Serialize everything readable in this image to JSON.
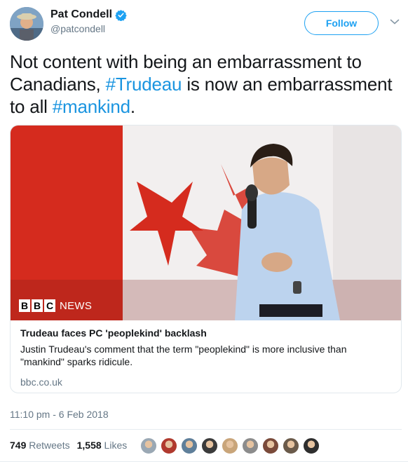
{
  "author": {
    "name": "Pat Condell",
    "handle": "@patcondell"
  },
  "follow_label": "Follow",
  "tweet": {
    "segments": [
      {
        "text": "Not content with being an embarrassment to Canadians, ",
        "hashtag": false
      },
      {
        "text": "#Trudeau",
        "hashtag": true
      },
      {
        "text": " is now an embarrassment to all ",
        "hashtag": false
      },
      {
        "text": "#mankind",
        "hashtag": true
      },
      {
        "text": ".",
        "hashtag": false
      }
    ]
  },
  "card": {
    "brand_letters": [
      "B",
      "B",
      "C"
    ],
    "brand_suffix": "NEWS",
    "title": "Trudeau faces PC 'peoplekind' backlash",
    "description": "Justin Trudeau's comment that the term \"peoplekind\" is more inclusive than \"mankind\" sparks ridicule.",
    "domain": "bbc.co.uk"
  },
  "timestamp": "11:10 pm - 6 Feb 2018",
  "stats": {
    "retweets_count": "749",
    "retweets_label": "Retweets",
    "likes_count": "1,558",
    "likes_label": "Likes"
  },
  "colors": {
    "accent": "#1da1f2",
    "hashtag": "#1b95e0",
    "muted": "#657786",
    "flag_red": "#d52b1e"
  },
  "liker_colors": [
    "#9aa8b4",
    "#b03a2e",
    "#5f7f9a",
    "#3b3b3b",
    "#c9a57a",
    "#8c8c8c",
    "#7a4a3a",
    "#6a5a4a",
    "#2e2e2e"
  ]
}
